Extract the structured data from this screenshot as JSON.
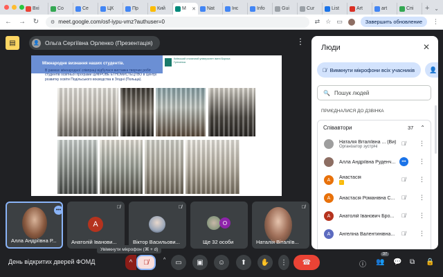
{
  "browser": {
    "tabs": [
      {
        "label": "Вхі",
        "fav_color": "#ea4335"
      },
      {
        "label": "Co",
        "fav_color": "#34a853"
      },
      {
        "label": "Се",
        "fav_color": "#4285f4"
      },
      {
        "label": "ЦК",
        "fav_color": "#4285f4"
      },
      {
        "label": "Пр",
        "fav_color": "#4285f4"
      },
      {
        "label": "Кий",
        "fav_color": "#fbbc04"
      },
      {
        "label": "M",
        "fav_color": "#00897b"
      },
      {
        "label": "Nat",
        "fav_color": "#4285f4"
      },
      {
        "label": "Інс",
        "fav_color": "#4285f4"
      },
      {
        "label": "Info",
        "fav_color": "#4285f4"
      },
      {
        "label": "Gui",
        "fav_color": "#9aa0a6"
      },
      {
        "label": "Cur",
        "fav_color": "#9aa0a6"
      },
      {
        "label": "List",
        "fav_color": "#1a73e8"
      },
      {
        "label": "Art",
        "fav_color": "#d93025"
      },
      {
        "label": "art",
        "fav_color": "#4285f4"
      },
      {
        "label": "Спі",
        "fav_color": "#34a853"
      }
    ],
    "url": "meet.google.com/osf-iypu-vmz?authuser=0",
    "update_label": "Завершить обновление",
    "icons": {
      "back": "back-arrow-icon",
      "forward": "forward-arrow-icon",
      "reload": "reload-icon"
    }
  },
  "meet": {
    "presenter": "Ольга Сергіївна Орленко (Презентація)",
    "meeting_title": "День відкритих дверей ФОМД",
    "mic_tooltip": "Увімкнути мікрофон (⌘ + d)",
    "people_badge": "37",
    "slide": {
      "badge": "Міжнародне визнання наших студентів.",
      "university": "Київський столичний університет імені Бориса Грінченка",
      "text": "В рамках міжнародної співпраці відбулася виставка творчих робіт студентів освітньої програми ЦИФРОВЕ ЕТНОМИСТЕЦТВО в Центрі розвитку освіти Подільського воєводства в Згодні (Польща)."
    },
    "tiles": [
      {
        "name": "Алла Андріївна Р...",
        "type": "video"
      },
      {
        "name": "Анатолій Іванови...",
        "type": "letter",
        "letter": "A",
        "color": "#b5331e"
      },
      {
        "name": "Віктор Васильови...",
        "type": "photo"
      },
      {
        "name": "Ще 32 особи",
        "type": "group",
        "letter": "O",
        "color": "#8e24aa"
      },
      {
        "name": "Наталія Віталіїв...",
        "type": "video"
      }
    ]
  },
  "people_panel": {
    "title": "Люди",
    "mute_all_label": "Вимкнути мікрофони всіх учасників",
    "search_placeholder": "Пошук людей",
    "section_label": "ПРИЄДНАЛИСЯ ДО ДЗВІНКА",
    "group_label": "Співавтори",
    "group_count": "37",
    "participants": [
      {
        "name": "Наталія Віталіївна ... (Ви)",
        "sub": "Організатор зустрічі",
        "av_color": "#9e9e9e",
        "letter": ""
      },
      {
        "name": "Алла Андріївна Руденч...",
        "sub": "",
        "av_color": "#8d6e63",
        "letter": ""
      },
      {
        "name": "Анастасія",
        "sub": "hand",
        "av_color": "#e8710a",
        "letter": "A"
      },
      {
        "name": "Анастасія Романівна С...",
        "sub": "",
        "av_color": "#e8710a",
        "letter": "A"
      },
      {
        "name": "Анатолій Іванович Бро...",
        "sub": "",
        "av_color": "#b5331e",
        "letter": "A"
      },
      {
        "name": "Ангеліна Валентинівна...",
        "sub": "",
        "av_color": "#5c6bc0",
        "letter": "A"
      }
    ]
  }
}
